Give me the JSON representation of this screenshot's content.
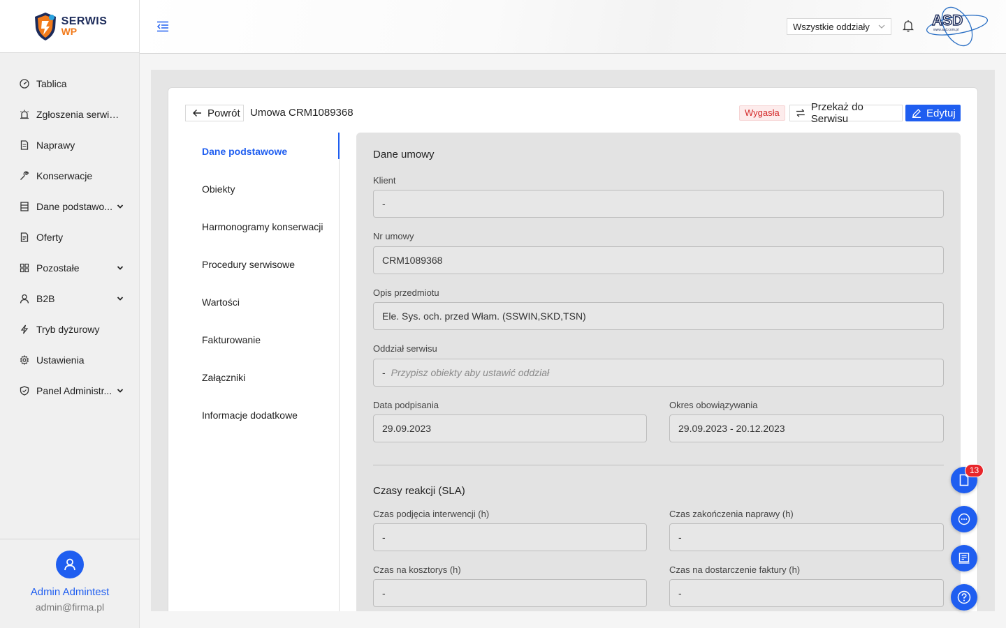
{
  "app": {
    "logo": {
      "line1": "SERWIS",
      "line2": "WP"
    },
    "colors": {
      "accent": "#1f5ef0",
      "danger": "#d42b2b",
      "badge": "#e8262b"
    }
  },
  "sidebar": {
    "items": [
      {
        "label": "Tablica",
        "icon": "dashboard-icon"
      },
      {
        "label": "Zgłoszenia serwiso...",
        "icon": "alarm-icon"
      },
      {
        "label": "Naprawy",
        "icon": "document-icon"
      },
      {
        "label": "Konserwacje",
        "icon": "wrench-icon"
      },
      {
        "label": "Dane podstawo...",
        "icon": "database-icon",
        "expandable": true
      },
      {
        "label": "Oferty",
        "icon": "offer-icon"
      },
      {
        "label": "Pozostałe",
        "icon": "grid-icon",
        "expandable": true
      },
      {
        "label": "B2B",
        "icon": "user-icon",
        "expandable": true
      },
      {
        "label": "Tryb dyżurowy",
        "icon": "lightning-icon"
      },
      {
        "label": "Ustawienia",
        "icon": "gear-icon"
      },
      {
        "label": "Panel Administr...",
        "icon": "shield-icon",
        "expandable": true
      }
    ],
    "user": {
      "name": "Admin Admintest",
      "email": "admin@firma.pl"
    }
  },
  "header": {
    "branch_select": "Wszystkie oddziały",
    "partner_logo": {
      "text": "ASD",
      "sub": "www.asd.com.pl"
    }
  },
  "page": {
    "back_label": "Powrót",
    "title": "Umowa CRM1089368",
    "status": "Wygasła",
    "transfer_label": "Przekaż do Serwisu",
    "edit_label": "Edytuj"
  },
  "tabs": [
    {
      "label": "Dane podstawowe",
      "active": true
    },
    {
      "label": "Obiekty"
    },
    {
      "label": "Harmonogramy konserwacji"
    },
    {
      "label": "Procedury serwisowe"
    },
    {
      "label": "Wartości"
    },
    {
      "label": "Fakturowanie"
    },
    {
      "label": "Załączniki"
    },
    {
      "label": "Informacje dodatkowe"
    }
  ],
  "contract": {
    "section_title": "Dane umowy",
    "client_label": "Klient",
    "client_value": "-",
    "number_label": "Nr umowy",
    "number_value": "CRM1089368",
    "description_label": "Opis przedmiotu",
    "description_value": "Ele. Sys. och. przed Włam. (SSWIN,SKD,TSN)",
    "branch_label": "Oddział serwisu",
    "branch_value": "-",
    "branch_placeholder": "Przypisz obiekty aby ustawić oddział",
    "signed_label": "Data podpisania",
    "signed_value": "29.09.2023",
    "period_label": "Okres obowiązywania",
    "period_value": "29.09.2023 - 20.12.2023"
  },
  "sla": {
    "section_title": "Czasy reakcji (SLA)",
    "intervention_label": "Czas podjęcia interwencji (h)",
    "intervention_value": "-",
    "repair_label": "Czas zakończenia naprawy (h)",
    "repair_value": "-",
    "estimate_label": "Czas na kosztorys (h)",
    "estimate_value": "-",
    "invoice_label": "Czas na dostarczenie faktury (h)",
    "invoice_value": "-"
  },
  "fabs": {
    "documents_badge": "13"
  }
}
